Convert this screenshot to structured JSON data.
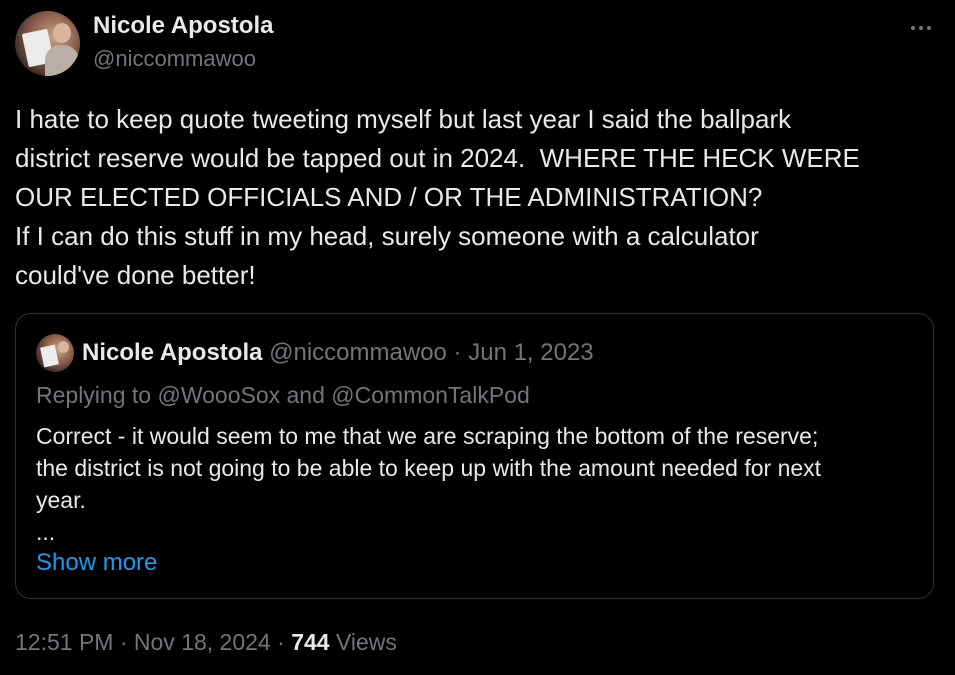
{
  "author": {
    "name": "Nicole Apostola",
    "handle": "@niccommawoo"
  },
  "tweet": {
    "text": "I hate to keep quote tweeting myself but last year I said the ballpark\ndistrict reserve would be tapped out in 2024.  WHERE THE HECK WERE\nOUR ELECTED OFFICIALS AND / OR THE ADMINISTRATION?\nIf I can do this stuff in my head, surely someone with a calculator\ncould've done better!"
  },
  "quoted_tweet": {
    "name": "Nicole Apostola",
    "handle": "@niccommawoo",
    "separator": " · ",
    "date": "Jun 1, 2023",
    "replying_prefix": "Replying to ",
    "replying_to_1": "@WoooSox",
    "replying_and": " and ",
    "replying_to_2": "@CommonTalkPod",
    "text": "Correct - it would seem to me that we are scraping the bottom of the reserve;\nthe district is not going to be able to keep up with the amount needed for next\nyear.\n...",
    "show_more_label": "Show more"
  },
  "footer": {
    "time": "12:51 PM",
    "separator": " · ",
    "date": "Nov 18, 2024",
    "views_count": "744",
    "views_label": " Views"
  },
  "icons": {
    "more": "more-horizontal-icon"
  },
  "colors": {
    "background": "#000000",
    "text": "#e7e9ea",
    "secondary": "#71767b",
    "link": "#1d9bf0",
    "border": "#2f3336"
  }
}
